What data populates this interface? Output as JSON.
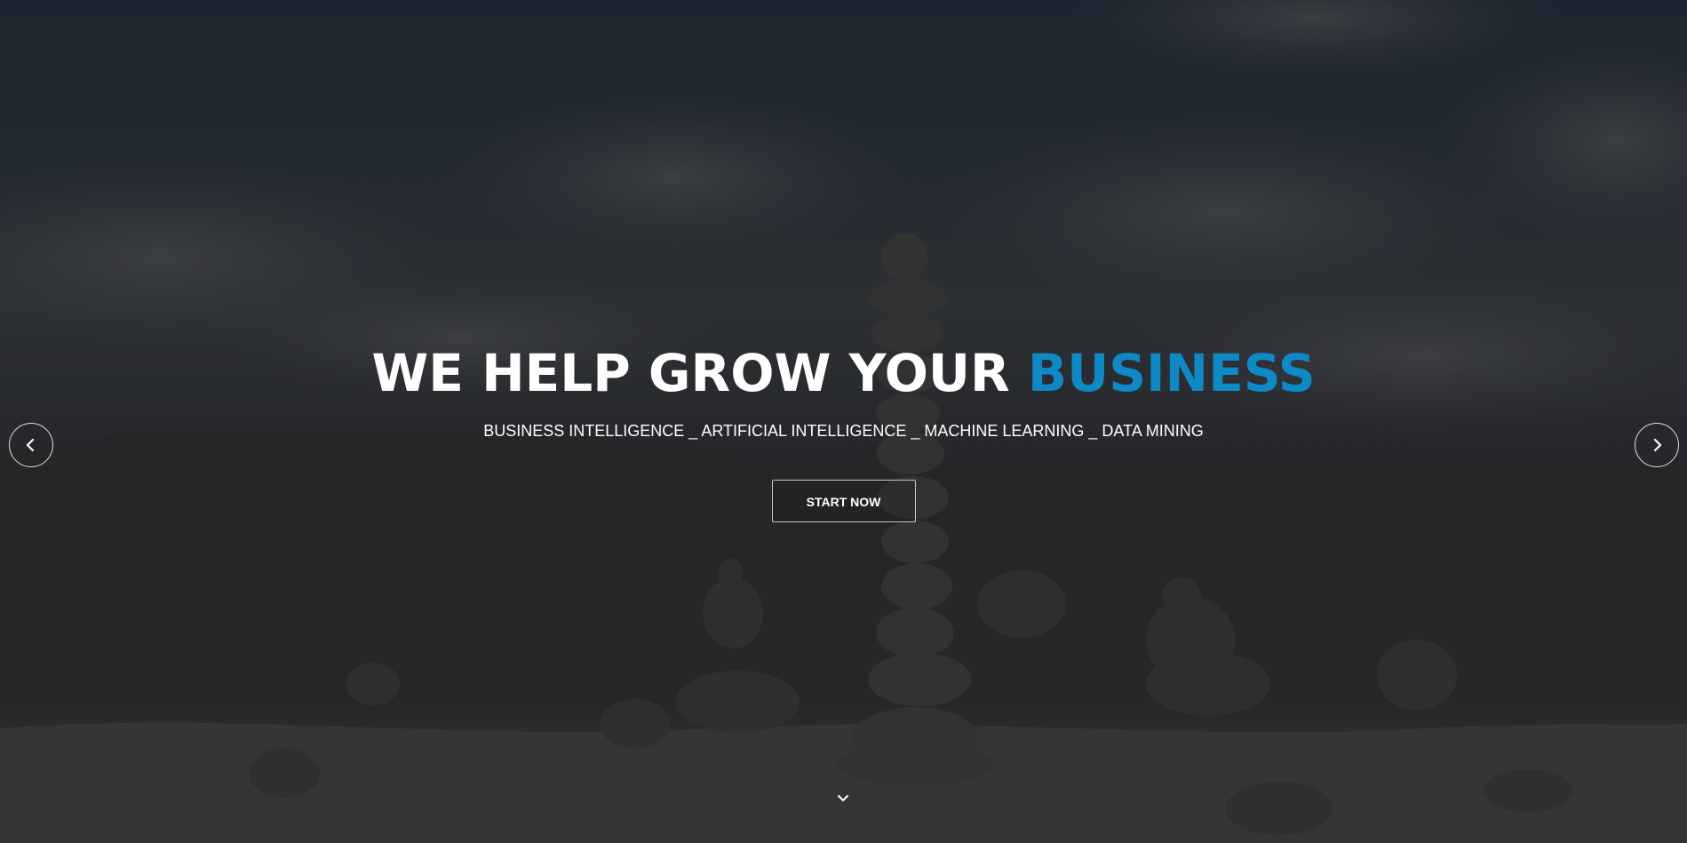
{
  "hero": {
    "title_main": "WE HELP GROW YOUR",
    "title_accent": "BUSINESS",
    "subtitle": "BUSINESS INTELLIGENCE _ ARTIFICIAL INTELLIGENCE _ MACHINE LEARNING _ DATA MINING",
    "cta_label": "START NOW",
    "accent_color": "#0d8ac6"
  },
  "carousel": {
    "prev_icon": "chevron-left-icon",
    "next_icon": "chevron-right-icon"
  },
  "scroll": {
    "icon": "chevron-down-icon"
  }
}
